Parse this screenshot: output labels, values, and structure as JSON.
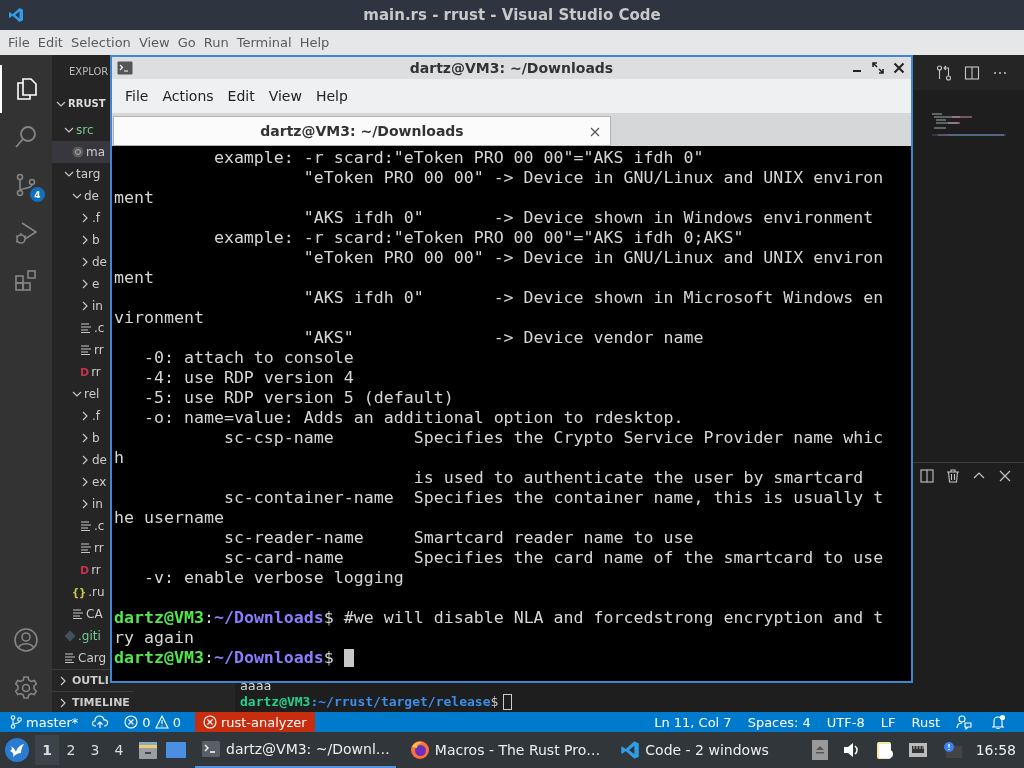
{
  "vscode": {
    "title": "main.rs - rrust - Visual Studio Code",
    "menu": [
      "File",
      "Edit",
      "Selection",
      "View",
      "Go",
      "Run",
      "Terminal",
      "Help"
    ],
    "activity_bar": [
      {
        "kind": "explorer",
        "selected": true
      },
      {
        "kind": "search",
        "selected": false
      },
      {
        "kind": "source-control",
        "selected": false,
        "badge": "4"
      },
      {
        "kind": "debug",
        "selected": false
      },
      {
        "kind": "extensions",
        "selected": false
      }
    ],
    "explorer": {
      "header": "EXPLOR",
      "tree": [
        {
          "label": "RRUST",
          "kind": "workspace",
          "expanded": true,
          "selected": false,
          "untracked": false,
          "children": [
            {
              "label": "src",
              "kind": "folder",
              "expanded": true,
              "selected": false,
              "untracked": true,
              "children": [
                {
                  "label": "ma",
                  "kind": "rust-file",
                  "selected": true,
                  "untracked": false
                }
              ]
            },
            {
              "label": "targ",
              "kind": "folder",
              "expanded": true,
              "selected": false,
              "untracked": false,
              "children": [
                {
                  "label": "de",
                  "kind": "folder",
                  "expanded": true,
                  "selected": false,
                  "untracked": false,
                  "children": [
                    {
                      "label": ".f",
                      "kind": "folder",
                      "expanded": false,
                      "selected": false,
                      "untracked": false
                    },
                    {
                      "label": "b",
                      "kind": "folder",
                      "expanded": false,
                      "selected": false,
                      "untracked": false
                    },
                    {
                      "label": "de",
                      "kind": "folder",
                      "expanded": false,
                      "selected": false,
                      "untracked": false
                    },
                    {
                      "label": "e",
                      "kind": "folder",
                      "expanded": false,
                      "selected": false,
                      "untracked": false
                    },
                    {
                      "label": "in",
                      "kind": "folder",
                      "expanded": false,
                      "selected": false,
                      "untracked": false
                    },
                    {
                      "label": ".c",
                      "kind": "text-file",
                      "selected": false,
                      "untracked": false
                    },
                    {
                      "label": "rr",
                      "kind": "text-file",
                      "selected": false,
                      "untracked": false
                    },
                    {
                      "label": "rr",
                      "kind": "d-file",
                      "icon_text": "D",
                      "selected": false,
                      "untracked": false
                    }
                  ]
                },
                {
                  "label": "rel",
                  "kind": "folder",
                  "expanded": true,
                  "selected": false,
                  "untracked": false,
                  "children": [
                    {
                      "label": ".f",
                      "kind": "folder",
                      "expanded": false,
                      "selected": false,
                      "untracked": false
                    },
                    {
                      "label": "b",
                      "kind": "folder",
                      "expanded": false,
                      "selected": false,
                      "untracked": false
                    },
                    {
                      "label": "de",
                      "kind": "folder",
                      "expanded": false,
                      "selected": false,
                      "untracked": false
                    },
                    {
                      "label": "ex",
                      "kind": "folder",
                      "expanded": false,
                      "selected": false,
                      "untracked": false
                    },
                    {
                      "label": "in",
                      "kind": "folder",
                      "expanded": false,
                      "selected": false,
                      "untracked": false
                    },
                    {
                      "label": ".c",
                      "kind": "text-file",
                      "selected": false,
                      "untracked": false
                    },
                    {
                      "label": "rr",
                      "kind": "text-file",
                      "selected": false,
                      "untracked": false
                    },
                    {
                      "label": "rr",
                      "kind": "d-file",
                      "icon_text": "D",
                      "selected": false,
                      "untracked": false
                    }
                  ]
                },
                {
                  "label": ".ru",
                  "kind": "json-file",
                  "icon_text": "{}",
                  "selected": false,
                  "untracked": false
                },
                {
                  "label": "CA",
                  "kind": "text-file",
                  "selected": false,
                  "untracked": false
                }
              ]
            },
            {
              "label": ".giti",
              "kind": "git-file",
              "selected": false,
              "untracked": true
            },
            {
              "label": "Carg",
              "kind": "text-file",
              "selected": false,
              "untracked": false
            }
          ]
        }
      ],
      "sections": [
        {
          "label": "OUTLI",
          "expanded": false
        },
        {
          "label": "TIMELINE",
          "expanded": false
        }
      ]
    },
    "panel": {
      "lines": [
        {
          "kind": "output",
          "text": "aaaa"
        },
        {
          "kind": "prompt",
          "segments": [
            {
              "kind": "user",
              "text": "dartz@VM3"
            },
            {
              "kind": "path",
              "text": ":~/rrust/target/release"
            },
            {
              "kind": "plain",
              "text": "$"
            }
          ],
          "cursor": true
        }
      ]
    },
    "status_bar": {
      "branch": "master*",
      "errors": "0",
      "warnings": "0",
      "server": "rust-analyzer",
      "right": [
        "Ln 11, Col 7",
        "Spaces: 4",
        "UTF-8",
        "LF",
        "Rust"
      ]
    }
  },
  "terminal": {
    "title": "dartz@VM3: ~/Downloads",
    "menu": [
      "File",
      "Actions",
      "Edit",
      "View",
      "Help"
    ],
    "tabs": [
      {
        "label": "dartz@VM3: ~/Downloads",
        "selected": true
      }
    ],
    "lines": [
      {
        "kind": "output",
        "text": "          example: -r scard:\"eToken PRO 00 00\"=\"AKS ifdh 0\""
      },
      {
        "kind": "output",
        "text": "                   \"eToken PRO 00 00\" -> Device in GNU/Linux and UNIX environ"
      },
      {
        "kind": "output",
        "text": "ment"
      },
      {
        "kind": "output",
        "text": "                   \"AKS ifdh 0\"       -> Device shown in Windows environment"
      },
      {
        "kind": "output",
        "text": "          example: -r scard:\"eToken PRO 00 00\"=\"AKS ifdh 0;AKS\""
      },
      {
        "kind": "output",
        "text": "                   \"eToken PRO 00 00\" -> Device in GNU/Linux and UNIX environ"
      },
      {
        "kind": "output",
        "text": "ment"
      },
      {
        "kind": "output",
        "text": "                   \"AKS ifdh 0\"       -> Device shown in Microsoft Windows en"
      },
      {
        "kind": "output",
        "text": "vironment"
      },
      {
        "kind": "output",
        "text": "                   \"AKS\"              -> Device vendor name"
      },
      {
        "kind": "output",
        "text": "   -0: attach to console"
      },
      {
        "kind": "output",
        "text": "   -4: use RDP version 4"
      },
      {
        "kind": "output",
        "text": "   -5: use RDP version 5 (default)"
      },
      {
        "kind": "output",
        "text": "   -o: name=value: Adds an additional option to rdesktop."
      },
      {
        "kind": "output",
        "text": "           sc-csp-name        Specifies the Crypto Service Provider name whic"
      },
      {
        "kind": "output",
        "text": "h"
      },
      {
        "kind": "output",
        "text": "                              is used to authenticate the user by smartcard"
      },
      {
        "kind": "output",
        "text": "           sc-container-name  Specifies the container name, this is usually t"
      },
      {
        "kind": "output",
        "text": "he username"
      },
      {
        "kind": "output",
        "text": "           sc-reader-name     Smartcard reader name to use"
      },
      {
        "kind": "output",
        "text": "           sc-card-name       Specifies the card name of the smartcard to use"
      },
      {
        "kind": "output",
        "text": "   -v: enable verbose logging"
      },
      {
        "kind": "blank"
      },
      {
        "kind": "prompt",
        "segments": [
          {
            "kind": "user",
            "text": "dartz@VM3"
          },
          {
            "kind": "plain",
            "text": ":"
          },
          {
            "kind": "path",
            "text": "~/Downloads"
          },
          {
            "kind": "plain",
            "text": "$ #we will disable NLA and forcedstrong encryption and t"
          }
        ]
      },
      {
        "kind": "output",
        "text": "ry again"
      },
      {
        "kind": "prompt",
        "segments": [
          {
            "kind": "user",
            "text": "dartz@VM3"
          },
          {
            "kind": "plain",
            "text": ":"
          },
          {
            "kind": "path",
            "text": "~/Downloads"
          },
          {
            "kind": "plain",
            "text": "$"
          }
        ],
        "cursor": true
      }
    ]
  },
  "taskbar": {
    "workspaces": [
      {
        "label": "1",
        "selected": true
      },
      {
        "label": "2",
        "selected": false
      },
      {
        "label": "3",
        "selected": false
      },
      {
        "label": "4",
        "selected": false
      }
    ],
    "tasks": [
      {
        "label": "dartz@VM3: ~/Downl…",
        "kind": "terminal",
        "selected": true
      },
      {
        "label": "Macros - The Rust Pro…",
        "kind": "browser",
        "selected": false
      },
      {
        "label": "Code - 2 windows",
        "kind": "editor",
        "selected": false
      }
    ],
    "clock": "16:58"
  }
}
